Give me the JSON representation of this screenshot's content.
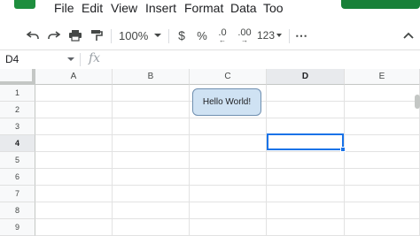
{
  "menubar": {
    "items": [
      {
        "id": "file",
        "label": "File"
      },
      {
        "id": "edit",
        "label": "Edit"
      },
      {
        "id": "view",
        "label": "View"
      },
      {
        "id": "insert",
        "label": "Insert"
      },
      {
        "id": "format",
        "label": "Format"
      },
      {
        "id": "data",
        "label": "Data"
      },
      {
        "id": "tools",
        "label": "Too"
      }
    ]
  },
  "toolbar": {
    "zoom": "100%",
    "currency": "$",
    "percent": "%",
    "decrease_decimals": ".0",
    "increase_decimals": ".00",
    "number_format": "123",
    "more": "⋯"
  },
  "formula_bar": {
    "name_box": "D4",
    "fx": "fx",
    "value": ""
  },
  "grid": {
    "columns": [
      "A",
      "B",
      "C",
      "D",
      "E"
    ],
    "rows": [
      "1",
      "2",
      "3",
      "4",
      "5",
      "6",
      "7",
      "8",
      "9"
    ],
    "selected_cell": "D4"
  },
  "shape": {
    "label": "Hello World!",
    "fill_color": "#cfe2f3"
  },
  "colors": {
    "selection": "#1a73e8",
    "brand_green": "#188038"
  }
}
